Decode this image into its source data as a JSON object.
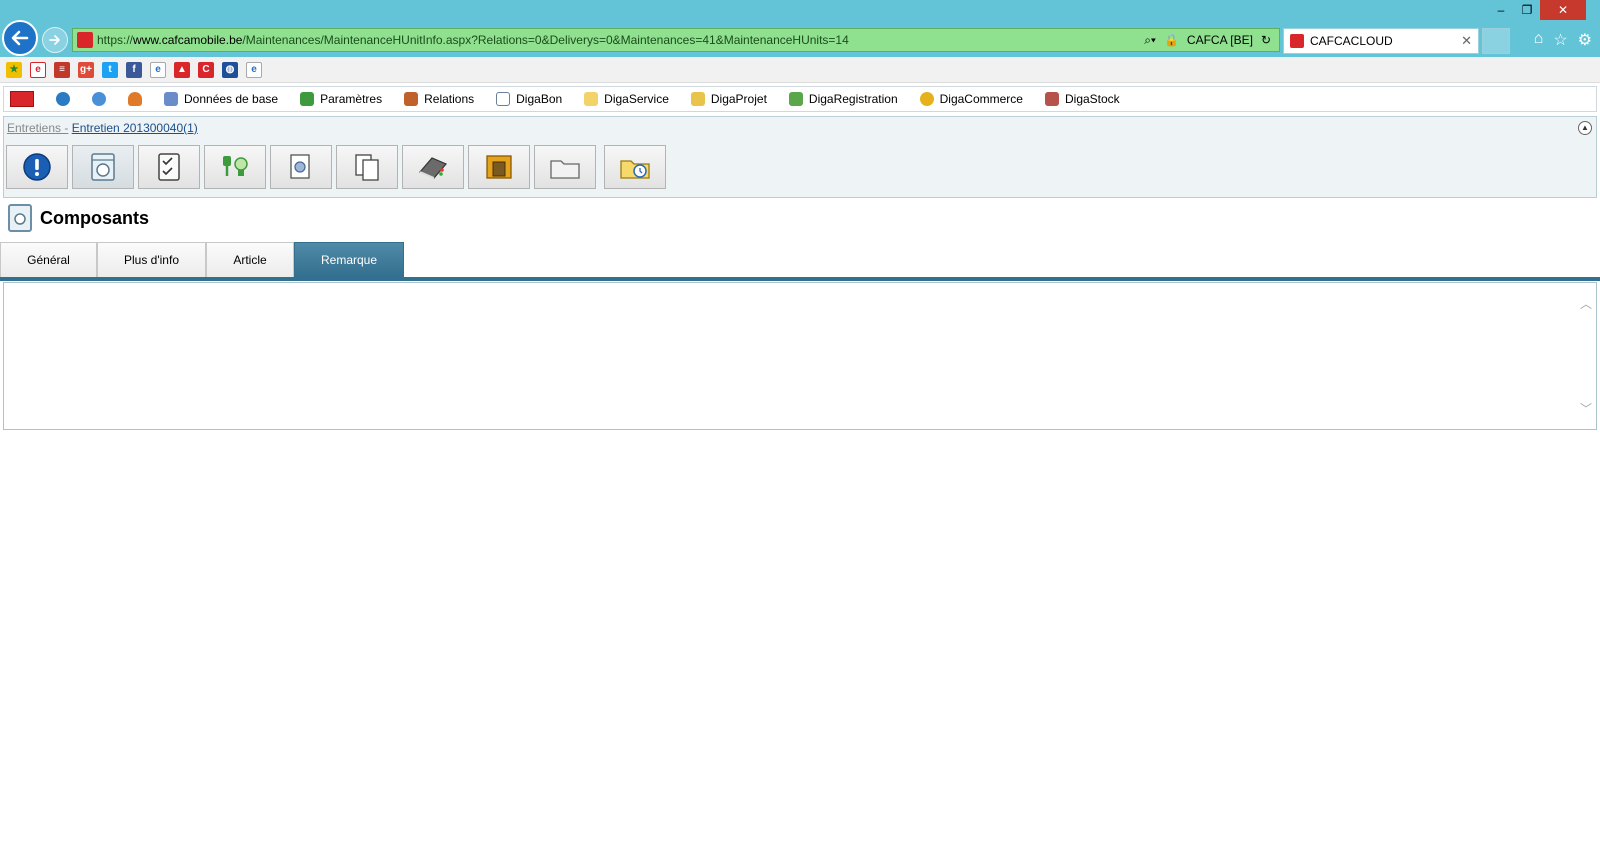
{
  "browser": {
    "url_scheme": "https://",
    "url_domain": "www.cafcamobile.be",
    "url_path": "/Maintenances/MaintenanceHUnitInfo.aspx?Relations=0&Deliverys=0&Maintenances=41&MaintenanceHUnits=14",
    "cert_label": "CAFCA [BE]",
    "tab_title": "CAFCACLOUD",
    "accent": "#63c4d8"
  },
  "appmenu": {
    "items": [
      {
        "label": "Données de base",
        "icon": "database-icon"
      },
      {
        "label": "Paramètres",
        "icon": "settings-icon"
      },
      {
        "label": "Relations",
        "icon": "relations-icon"
      },
      {
        "label": "DigaBon",
        "icon": "document-icon"
      },
      {
        "label": "DigaService",
        "icon": "service-icon"
      },
      {
        "label": "DigaProjet",
        "icon": "project-icon"
      },
      {
        "label": "DigaRegistration",
        "icon": "registration-icon"
      },
      {
        "label": "DigaCommerce",
        "icon": "commerce-icon"
      },
      {
        "label": "DigaStock",
        "icon": "stock-icon"
      }
    ]
  },
  "breadcrumb": {
    "parent": "Entretiens -",
    "current": "Entretien 201300040(1)"
  },
  "section": {
    "title": "Composants"
  },
  "tabs": [
    {
      "label": "Général",
      "active": false
    },
    {
      "label": "Plus d'info",
      "active": false
    },
    {
      "label": "Article",
      "active": false
    },
    {
      "label": "Remarque",
      "active": true
    }
  ],
  "remark": {
    "value": ""
  }
}
